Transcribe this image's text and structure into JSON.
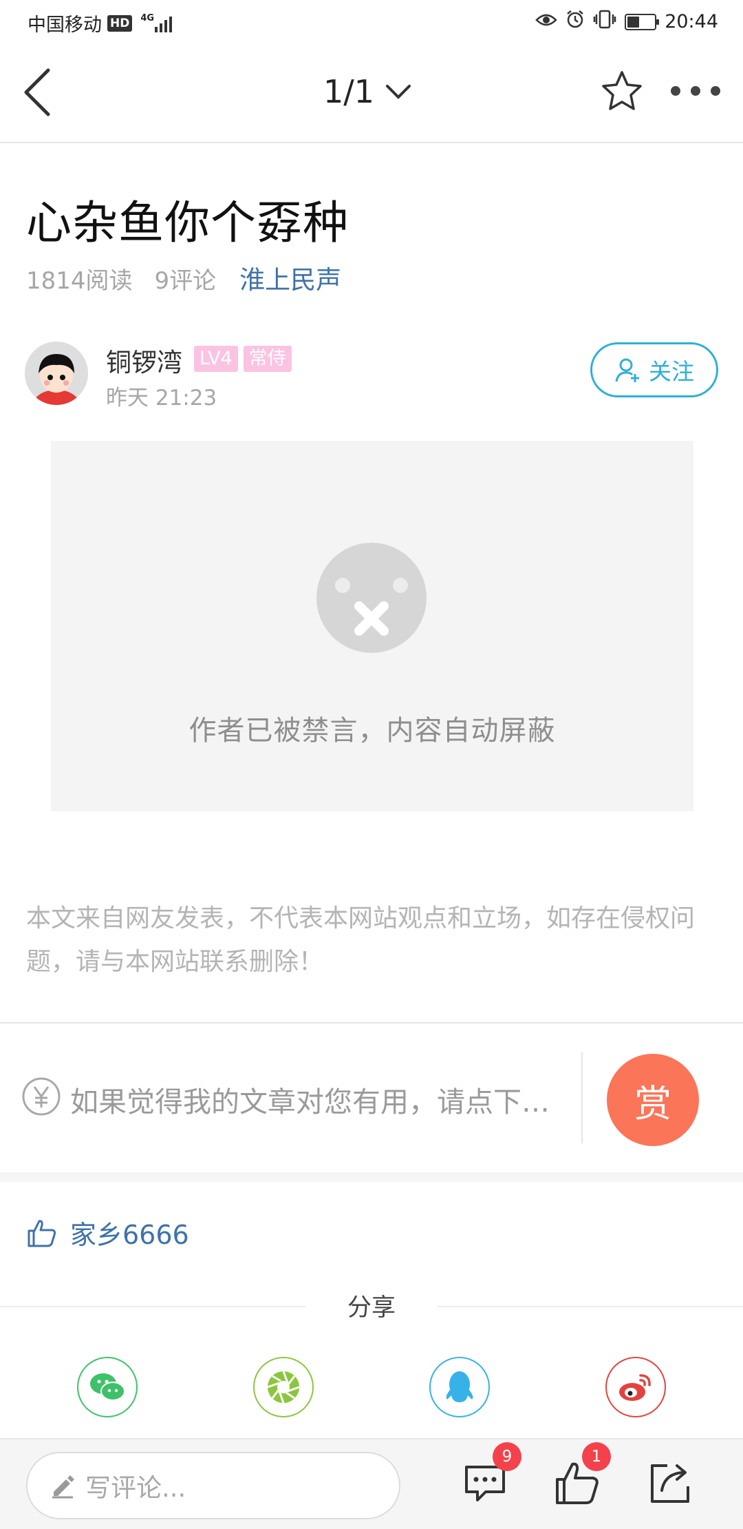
{
  "status_bar": {
    "carrier": "中国移动",
    "hd": "HD",
    "network": "4G",
    "time": "20:44",
    "icons": [
      "eye-icon",
      "alarm-icon",
      "vibrate-icon",
      "battery-icon"
    ]
  },
  "nav": {
    "page_indicator": "1/1",
    "icons": [
      "back-arrow-icon",
      "chevron-down-icon",
      "star-icon",
      "more-dots-icon"
    ]
  },
  "post": {
    "title": "心杂鱼你个孬种",
    "reads": "1814阅读",
    "comments": "9评论",
    "source": "淮上民声"
  },
  "author": {
    "name": "铜锣湾",
    "level": "LV4",
    "tag": "常侍",
    "time": "昨天 21:23",
    "follow_label": "关注",
    "badge_color": "#fbc3e2"
  },
  "blocked": {
    "message": "作者已被禁言，内容自动屏蔽"
  },
  "disclaimer": "本文来自网友发表，不代表本网站观点和立场，如存在侵权问题，请与本网站联系删除！",
  "reward": {
    "prompt": "如果觉得我的文章对您有用，请点下…",
    "button_label": "赏",
    "button_color": "#fb7558"
  },
  "likes": {
    "liker": "家乡6666"
  },
  "share": {
    "label": "分享",
    "targets": [
      "wechat-icon",
      "moments-icon",
      "qq-icon",
      "weibo-icon"
    ]
  },
  "bottom_bar": {
    "comment_placeholder": "写评论...",
    "comment_count": "9",
    "like_count": "1",
    "icons": [
      "pencil-icon",
      "comment-icon",
      "thumb-up-icon",
      "share-icon"
    ]
  },
  "colors": {
    "accent_blue": "#2db0d6",
    "link_blue": "#3f72a8",
    "badge_red": "#f3424b"
  }
}
